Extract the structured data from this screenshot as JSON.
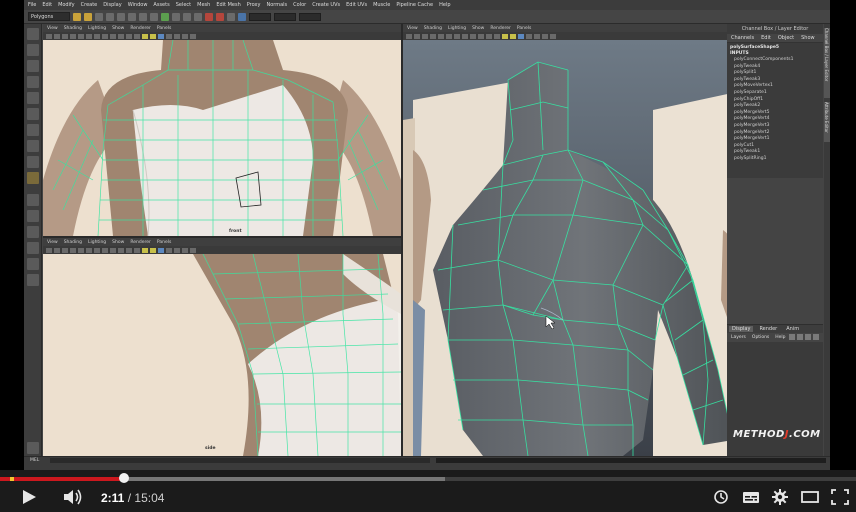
{
  "menubar": [
    "File",
    "Edit",
    "Modify",
    "Create",
    "Display",
    "Window",
    "Assets",
    "Select",
    "Mesh",
    "Edit Mesh",
    "Proxy",
    "Normals",
    "Color",
    "Create UVs",
    "Edit UVs",
    "Muscle",
    "Pipeline Cache",
    "Help"
  ],
  "statusline": {
    "mode": "Polygons"
  },
  "viewport_menu": [
    "View",
    "Shading",
    "Lighting",
    "Show",
    "Renderer",
    "Panels"
  ],
  "viewports": {
    "front": {
      "label": "front"
    },
    "side": {
      "label": "side"
    }
  },
  "channel_box": {
    "header": "Channel Box / Layer Editor",
    "tabs": [
      "Channels",
      "Edit",
      "Object",
      "Show"
    ],
    "shape": "polySurfaceShape5",
    "inputs_label": "INPUTS",
    "nodes": [
      "polyConnectComponents1",
      "polyTweak4",
      "polySplit1",
      "polyTweak3",
      "polyMoveVertex1",
      "polySeparate1",
      "polyChipOff1",
      "polyTweak2",
      "polyMergeVert5",
      "polyMergeVert4",
      "polyMergeVert3",
      "polyMergeVert2",
      "polyMergeVert1",
      "polyCut1",
      "polyTweak1",
      "polySplitRing1"
    ]
  },
  "side_tabs": [
    "Channel Box / Layer Editor",
    "Attribute Editor"
  ],
  "layer_editor": {
    "tabs": [
      "Display",
      "Render",
      "Anim"
    ],
    "menu": [
      "Layers",
      "Options",
      "Help"
    ]
  },
  "command_line": {
    "label": "MEL"
  },
  "watermark": {
    "prefix": "METHOD",
    "accent": "J",
    "suffix": ".COM"
  },
  "player": {
    "current_time": "2:11",
    "separator": "/",
    "duration": "15:04",
    "played_fraction": 0.145,
    "buffered_fraction": 0.52,
    "colors": {
      "played": "#cc181e",
      "buffered": "#777777",
      "track": "#3e3e3e"
    },
    "icons": [
      "play-icon",
      "volume-icon",
      "watch-later-icon",
      "captions-icon",
      "settings-gear-icon",
      "theater-mode-icon",
      "fullscreen-icon"
    ]
  }
}
